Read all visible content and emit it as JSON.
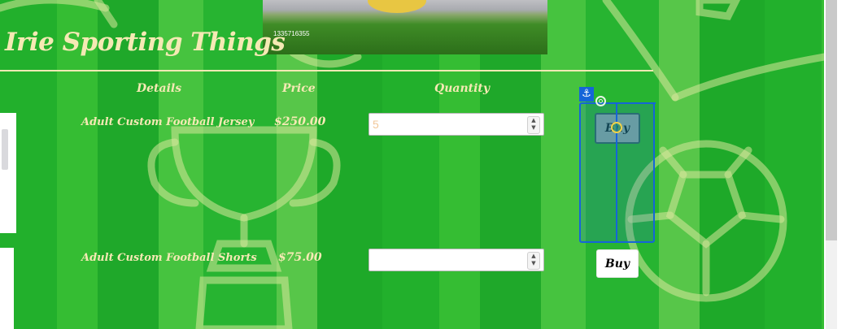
{
  "store": {
    "title": "Irie Sporting Things"
  },
  "hero": {
    "caption": "1335716355"
  },
  "table": {
    "headers": {
      "details": "Details",
      "price": "Price",
      "quantity": "Quantity"
    }
  },
  "products": [
    {
      "name": "Adult Custom Football Jersey",
      "price": "$250.00",
      "quantity": "5",
      "buy_label": "Buy"
    },
    {
      "name": "Adult Custom Football Shorts",
      "price": "$75.00",
      "quantity": "",
      "buy_label": "Buy"
    }
  ],
  "editor": {
    "anchor_icon": "⚓"
  },
  "colors": {
    "accent_text": "#f5e9b4",
    "selection": "#1565d8",
    "background_green": "#22b02c"
  }
}
